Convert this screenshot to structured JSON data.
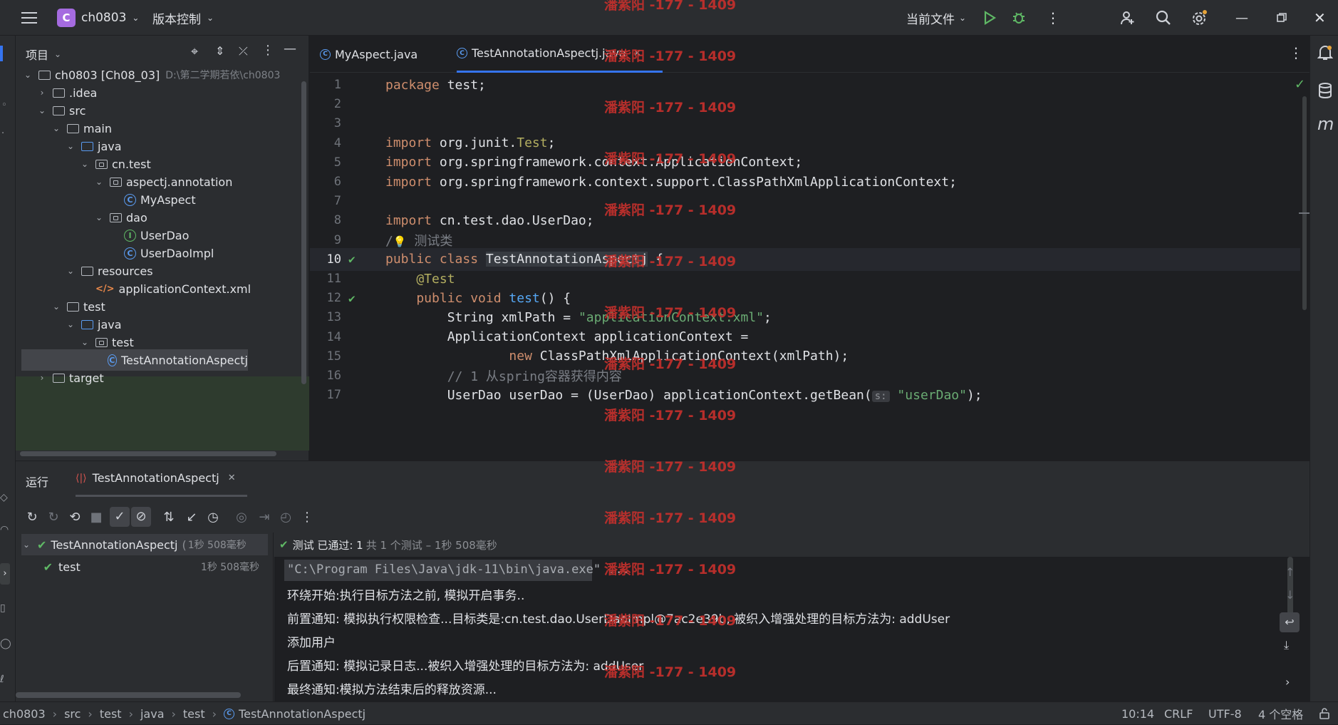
{
  "titlebar": {
    "project_badge": "C",
    "project_name": "ch0803",
    "vcs_label": "版本控制",
    "run_config": "当前文件"
  },
  "project_panel": {
    "title": "项目",
    "tree": [
      {
        "label": "ch0803 [Ch08_03]",
        "path": "D:\\第二学期若依\\ch0803",
        "icon": "module-folder-icon",
        "depth": 0,
        "expanded": true
      },
      {
        "label": ".idea",
        "icon": "folder-icon",
        "depth": 1,
        "expanded": false
      },
      {
        "label": "src",
        "icon": "folder-icon",
        "depth": 1,
        "expanded": true
      },
      {
        "label": "main",
        "icon": "folder-icon",
        "depth": 2,
        "expanded": true
      },
      {
        "label": "java",
        "icon": "source-folder-icon",
        "depth": 3,
        "expanded": true
      },
      {
        "label": "cn.test",
        "icon": "package-icon",
        "depth": 4,
        "expanded": true
      },
      {
        "label": "aspectj.annotation",
        "icon": "package-icon",
        "depth": 5,
        "expanded": true
      },
      {
        "label": "MyAspect",
        "icon": "class-icon",
        "depth": 6
      },
      {
        "label": "dao",
        "icon": "package-icon",
        "depth": 5,
        "expanded": true
      },
      {
        "label": "UserDao",
        "icon": "interface-icon",
        "depth": 6
      },
      {
        "label": "UserDaoImpl",
        "icon": "class-icon",
        "depth": 6
      },
      {
        "label": "resources",
        "icon": "resources-folder-icon",
        "depth": 3,
        "expanded": true
      },
      {
        "label": "applicationContext.xml",
        "icon": "xml-file-icon",
        "depth": 4
      },
      {
        "label": "test",
        "icon": "folder-icon",
        "depth": 2,
        "expanded": true
      },
      {
        "label": "java",
        "icon": "test-source-folder-icon",
        "depth": 3,
        "expanded": true
      },
      {
        "label": "test",
        "icon": "package-icon",
        "depth": 4,
        "expanded": true
      },
      {
        "label": "TestAnnotationAspectj",
        "icon": "class-icon",
        "depth": 5,
        "selected": true
      },
      {
        "label": "target",
        "icon": "folder-icon",
        "depth": 1,
        "expanded": false
      }
    ]
  },
  "editor": {
    "tabs": [
      {
        "label": "MyAspect.java",
        "active": false
      },
      {
        "label": "TestAnnotationAspectj.java",
        "active": true
      }
    ],
    "lines": [
      {
        "n": "1",
        "tokens": [
          [
            "kw",
            "package"
          ],
          [
            "",
            " test;"
          ]
        ]
      },
      {
        "n": "2",
        "tokens": []
      },
      {
        "n": "3",
        "tokens": []
      },
      {
        "n": "4",
        "tokens": [
          [
            "kw",
            "import"
          ],
          [
            "",
            " org.junit."
          ],
          [
            "ann",
            "Test"
          ],
          [
            "",
            ";"
          ]
        ]
      },
      {
        "n": "5",
        "tokens": [
          [
            "kw",
            "import"
          ],
          [
            "",
            " org.springframework.context.ApplicationContext;"
          ]
        ]
      },
      {
        "n": "6",
        "tokens": [
          [
            "kw",
            "import"
          ],
          [
            "",
            " org.springframework.context.support.ClassPathXmlApplicationContext;"
          ]
        ]
      },
      {
        "n": "7",
        "tokens": []
      },
      {
        "n": "8",
        "tokens": [
          [
            "kw",
            "import"
          ],
          [
            "",
            " cn.test.dao.UserDao;"
          ]
        ]
      },
      {
        "n": "9",
        "tokens": [
          [
            "cmt",
            "/"
          ],
          [
            "bulb",
            ""
          ],
          [
            "cmt",
            " 测试类"
          ]
        ]
      },
      {
        "n": "10",
        "tokens": [
          [
            "kw",
            "public class "
          ],
          [
            "hl",
            "TestAnnotationAspectj"
          ],
          [
            "",
            " {"
          ]
        ]
      },
      {
        "n": "11",
        "tokens": [
          [
            "ann",
            "    @Test"
          ]
        ]
      },
      {
        "n": "12",
        "tokens": [
          [
            "kw",
            "    public void "
          ],
          [
            "fn",
            "test"
          ],
          [
            "",
            "() {"
          ]
        ]
      },
      {
        "n": "13",
        "tokens": [
          [
            "",
            "        String xmlPath = "
          ],
          [
            "str",
            "\"applicationContext.xml\""
          ],
          [
            "",
            ";"
          ]
        ]
      },
      {
        "n": "14",
        "tokens": [
          [
            "",
            "        ApplicationContext applicationContext ="
          ]
        ]
      },
      {
        "n": "15",
        "tokens": [
          [
            "kw",
            "                new "
          ],
          [
            "",
            "ClassPathXmlApplicationContext(xmlPath);"
          ]
        ]
      },
      {
        "n": "16",
        "tokens": [
          [
            "cmt",
            "        // 1 从spring容器获得内容"
          ]
        ]
      },
      {
        "n": "17",
        "tokens": [
          [
            "",
            "        UserDao userDao = (UserDao) applicationContext.getBean("
          ],
          [
            "hint",
            "s:"
          ],
          [
            "str",
            " \"userDao\""
          ],
          [
            "",
            ");"
          ]
        ]
      }
    ],
    "hint_label": "s:"
  },
  "run_panel": {
    "title": "运行",
    "tab_label": "TestAnnotationAspectj",
    "tests": [
      {
        "label": "TestAnnotationAspectj",
        "extra": "(",
        "time": "1秒 508毫秒",
        "status": "passed"
      },
      {
        "label": "test",
        "time": "1秒 508毫秒",
        "status": "passed"
      }
    ],
    "summary_status": "测试 已通过: 1",
    "summary_detail": "共 1 个测试 – 1秒 508毫秒",
    "console": [
      "\"C:\\Program Files\\Java\\jdk-11\\bin\\java.exe\" ...",
      "环绕开始:执行目标方法之前, 模拟开启事务..",
      "前置通知: 模拟执行权限检查...目标类是:cn.test.dao.UserDaoImpl@7ac2e39b, 被织入增强处理的目标方法为: addUser",
      "添加用户",
      "后置通知: 模拟记录日志...被织入增强处理的目标方法为: addUser",
      "最终通知:模拟方法结束后的释放资源..."
    ]
  },
  "statusbar": {
    "breadcrumbs": [
      "ch0803",
      "src",
      "test",
      "java",
      "test",
      "TestAnnotationAspectj"
    ],
    "position": "10:14",
    "line_sep": "CRLF",
    "encoding": "UTF-8",
    "indent": "4 个空格"
  },
  "watermark": "潘紫阳 -177 - 1409",
  "colors": {
    "accent": "#3574f0",
    "pass_green": "#5fb865",
    "watermark_red": "#c3302c",
    "keyword": "#cf8e6d",
    "string": "#6aab73"
  }
}
